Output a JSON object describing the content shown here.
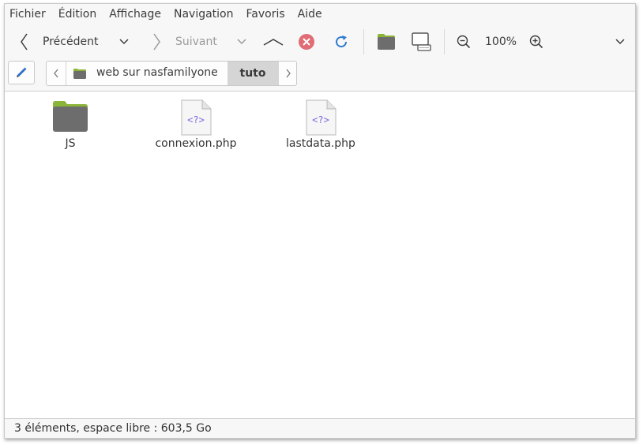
{
  "menu": {
    "items": [
      "Fichier",
      "Édition",
      "Affichage",
      "Navigation",
      "Favoris",
      "Aide"
    ]
  },
  "toolbar": {
    "back_label": "Précédent",
    "forward_label": "Suivant",
    "zoom_level": "100%"
  },
  "breadcrumb": {
    "items": [
      {
        "label": "web sur nasfamilyone",
        "icon": "nas-drive-icon"
      },
      {
        "label": "tuto",
        "current": true
      }
    ]
  },
  "files": [
    {
      "name": "JS",
      "type": "folder",
      "icon": "folder-icon"
    },
    {
      "name": "connexion.php",
      "type": "php",
      "icon": "php-file-icon",
      "glyph": "<?>"
    },
    {
      "name": "lastdata.php",
      "type": "php",
      "icon": "php-file-icon",
      "glyph": "<?>"
    }
  ],
  "status": {
    "text": "3 éléments, espace libre : 603,5 Go"
  },
  "colors": {
    "folder_body": "#6d6d6d",
    "folder_tab": "#8bb536",
    "stop_red": "#e06c75",
    "reload_blue": "#2f7bd0",
    "php_glyph": "#7d6ae0"
  }
}
